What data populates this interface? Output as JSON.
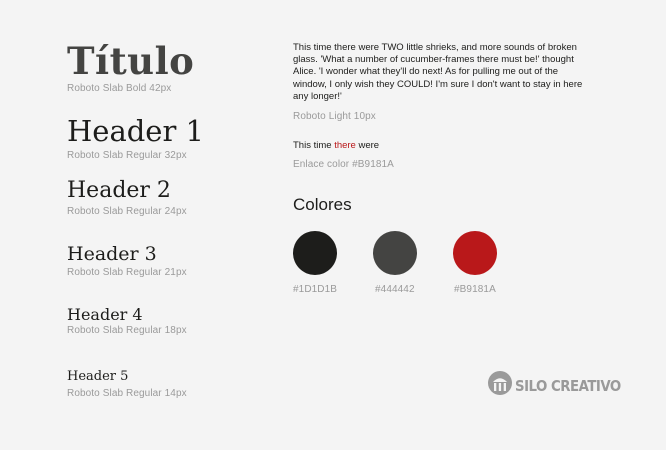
{
  "title": {
    "text": "Título",
    "note": "Roboto Slab  Bold 42px"
  },
  "headers": [
    {
      "text": "Header 1",
      "note": "Roboto Slab Regular 32px"
    },
    {
      "text": "Header 2",
      "note": "Roboto Slab Regular 24px"
    },
    {
      "text": "Header 3",
      "note": "Roboto Slab Regular 21px"
    },
    {
      "text": "Header 4",
      "note": "Roboto Slab Regular 18px"
    },
    {
      "text": "Header 5",
      "note": "Roboto Slab Regular 14px"
    }
  ],
  "body": {
    "paragraph": "This time there were TWO little shrieks, and more sounds of broken glass. 'What a number of cucumber-frames there must be!' thought Alice. 'I wonder what they'll do next! As for pulling me out of the window, I only wish they COULD! I'm sure I don't want to stay in here any longer!'",
    "note": "Roboto Light 10px",
    "link_before": "This time ",
    "link_text": "there",
    "link_after": " were",
    "link_note": "Enlace color #B9181A"
  },
  "colors": {
    "title": "Colores",
    "swatches": [
      {
        "hex": "#1D1D1B",
        "value": "#1d1d1b"
      },
      {
        "hex": "#444442",
        "value": "#444442"
      },
      {
        "hex": "#B9181A",
        "value": "#b9181a"
      }
    ]
  },
  "logo": {
    "text": "SILO CREATIVO",
    "icon": "silo-logo-icon"
  }
}
